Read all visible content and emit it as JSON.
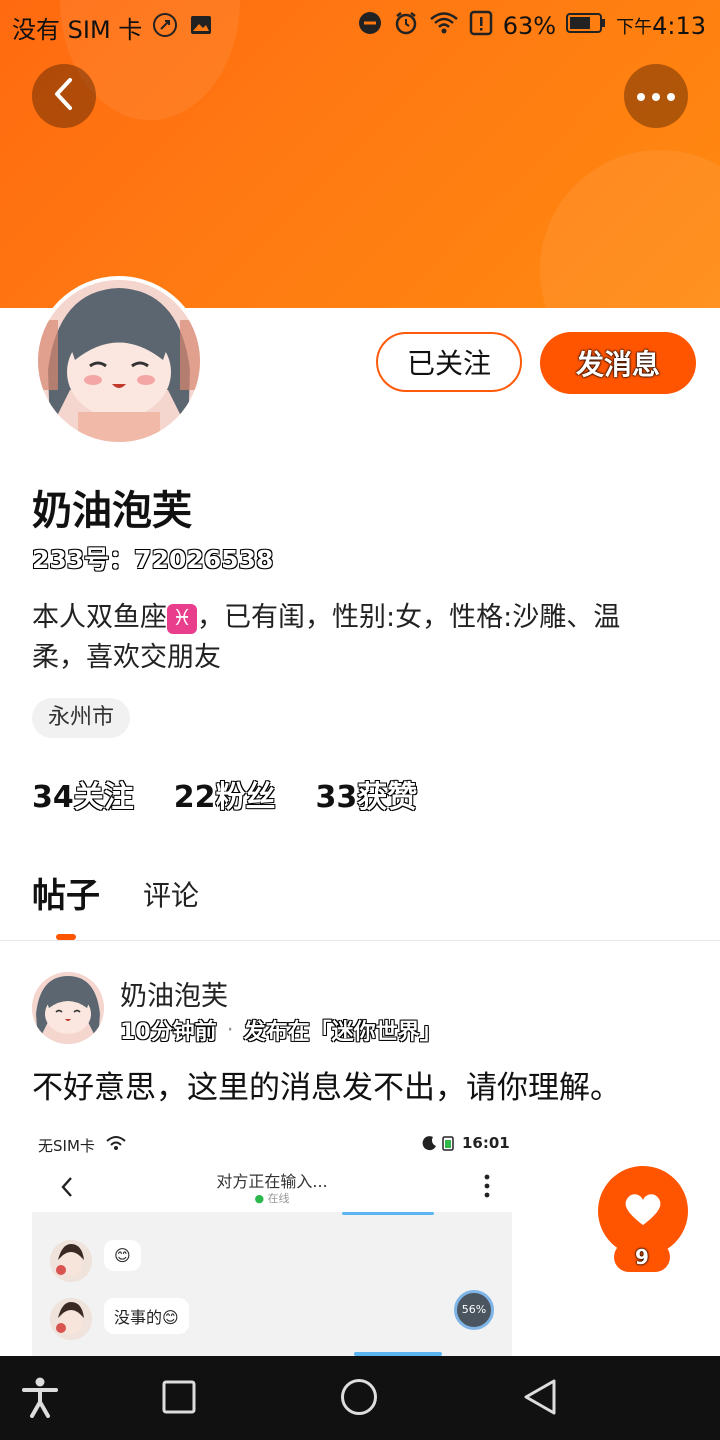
{
  "status_bar": {
    "carrier": "没有 SIM 卡",
    "battery": "63%",
    "time_prefix": "下午",
    "time": "4:13"
  },
  "header": {
    "back_icon": "chevron-left-icon",
    "more_icon": "more-dots-icon",
    "background_color": "#ff7a12"
  },
  "profile": {
    "name": "奶油泡芙",
    "id_label": "233号：72026538",
    "bio_before": "本人双鱼座",
    "zodiac_symbol": "♓",
    "bio_after": "，已有闺，性别:女，性格:沙雕、温柔，喜欢交朋友",
    "location_tag": "永州市",
    "follow_button": "已关注",
    "message_button": "发消息",
    "stats": [
      {
        "num": "34",
        "label": "关注"
      },
      {
        "num": "22",
        "label": "粉丝"
      },
      {
        "num": "33",
        "label": "获赞"
      }
    ]
  },
  "tabs": [
    {
      "label": "帖子",
      "active": true
    },
    {
      "label": "评论",
      "active": false
    }
  ],
  "post": {
    "author": "奶油泡芙",
    "time": "10分钟前",
    "separator": "·",
    "location": "发布在「迷你世界」",
    "text": "不好意思，这里的消息发不出，请你理解。",
    "screenshot": {
      "carrier": "无SIM卡",
      "time": "16:01",
      "title": "对方正在输入...",
      "subtitle": "在线",
      "msg1": "😊",
      "msg2": "没事的😊",
      "progress": "56%"
    },
    "like_count": "9"
  },
  "accent_color": "#ff5400"
}
